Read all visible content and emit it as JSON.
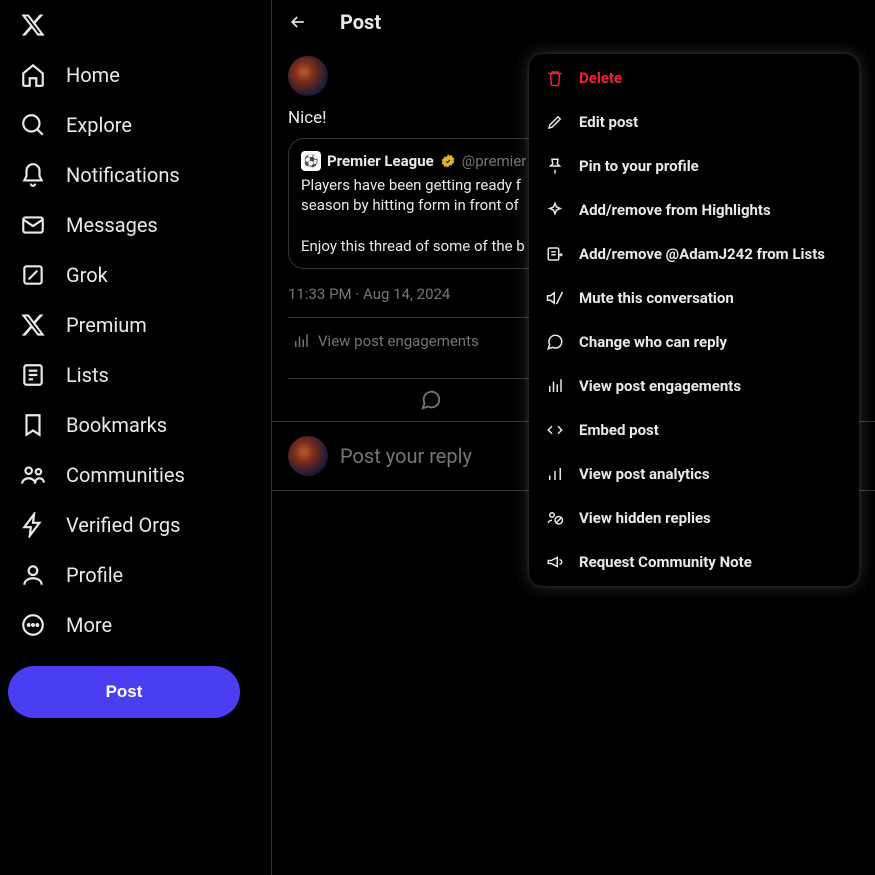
{
  "sidebar": {
    "items": [
      {
        "label": "Home"
      },
      {
        "label": "Explore"
      },
      {
        "label": "Notifications"
      },
      {
        "label": "Messages"
      },
      {
        "label": "Grok"
      },
      {
        "label": "Premium"
      },
      {
        "label": "Lists"
      },
      {
        "label": "Bookmarks"
      },
      {
        "label": "Communities"
      },
      {
        "label": "Verified Orgs"
      },
      {
        "label": "Profile"
      },
      {
        "label": "More"
      }
    ],
    "post_button": "Post"
  },
  "header": {
    "title": "Post"
  },
  "post": {
    "text": "Nice!",
    "timestamp": "11:33 PM · Aug 14, 2024",
    "engagements_label": "View post engagements",
    "quote": {
      "name": "Premier League",
      "handle": "@premier",
      "line1": "Players have been getting ready f",
      "line2": "season by hitting form in front of",
      "line3": "Enjoy this thread of some of the b"
    }
  },
  "reply": {
    "placeholder": "Post your reply"
  },
  "dropdown": {
    "items": [
      {
        "label": "Delete",
        "danger": true
      },
      {
        "label": "Edit post"
      },
      {
        "label": "Pin to your profile"
      },
      {
        "label": "Add/remove from Highlights"
      },
      {
        "label": "Add/remove @AdamJ242 from Lists"
      },
      {
        "label": "Mute this conversation"
      },
      {
        "label": "Change who can reply"
      },
      {
        "label": "View post engagements"
      },
      {
        "label": "Embed post"
      },
      {
        "label": "View post analytics"
      },
      {
        "label": "View hidden replies"
      },
      {
        "label": "Request Community Note"
      }
    ]
  }
}
